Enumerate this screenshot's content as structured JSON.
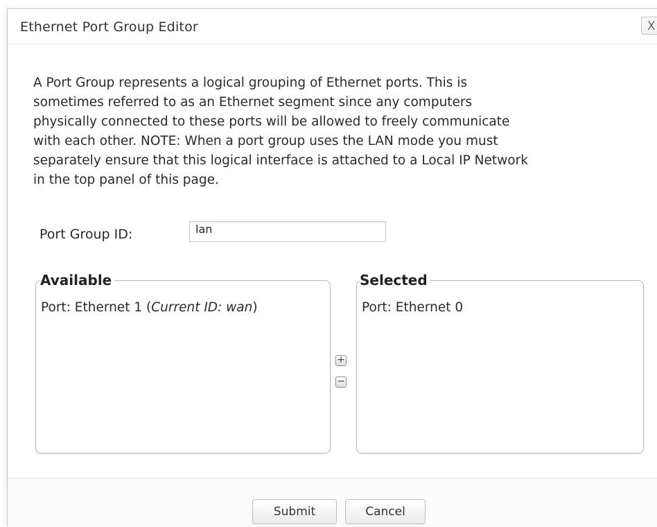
{
  "dialog": {
    "title": "Ethernet Port Group Editor",
    "close_glyph": "X",
    "description": "A Port Group represents a logical grouping of Ethernet ports. This is\nsometimes referred to as an Ethernet segment since any computers\nphysically connected to these ports will be allowed to freely communicate\nwith each other. NOTE: When a port group uses the LAN mode you must\nseparately ensure that this logical interface is attached to a Local IP Network\nin the top panel of this page."
  },
  "port_group_id": {
    "label": "Port Group ID:",
    "value": "lan"
  },
  "available": {
    "legend": "Available",
    "items": [
      {
        "prefix": "Port: Ethernet 1 (",
        "note": "Current ID: wan",
        "suffix": ")"
      }
    ]
  },
  "selected": {
    "legend": "Selected",
    "items": [
      {
        "label": "Port: Ethernet 0"
      }
    ]
  },
  "move_buttons": {
    "add_glyph": "+",
    "remove_glyph": "−"
  },
  "footer": {
    "submit_label": "Submit",
    "cancel_label": "Cancel"
  }
}
